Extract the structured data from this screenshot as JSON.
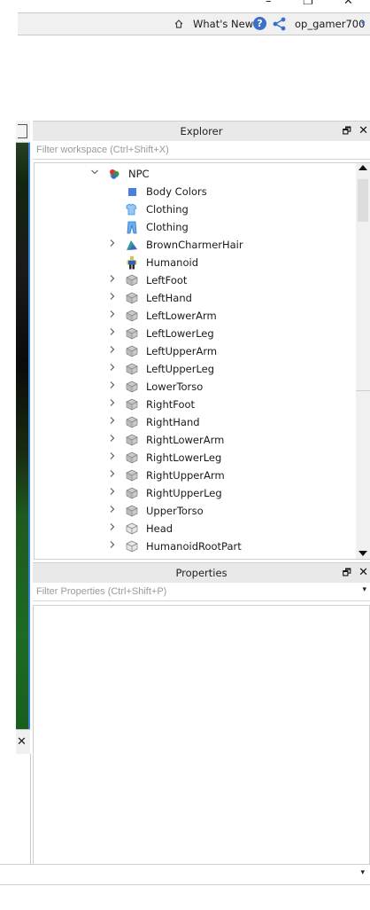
{
  "window_controls": {
    "minimize": "–",
    "restore": "❐",
    "close": "✕"
  },
  "topbar": {
    "whats_new": "What's New",
    "help": "?",
    "user": "op_gamer700",
    "dropdown": "▾"
  },
  "viewport": {
    "close": "✕"
  },
  "explorer": {
    "title": "Explorer",
    "float": "🗗",
    "close": "✕",
    "filter_placeholder": "Filter workspace (Ctrl+Shift+X)",
    "items": [
      {
        "label": "NPC",
        "icon": "model-icon",
        "expanded": true
      },
      {
        "label": "Body Colors",
        "icon": "body-colors-icon"
      },
      {
        "label": "Clothing",
        "icon": "shirt-icon"
      },
      {
        "label": "Clothing",
        "icon": "pants-icon"
      },
      {
        "label": "BrownCharmerHair",
        "icon": "accessory-icon"
      },
      {
        "label": "Humanoid",
        "icon": "humanoid-icon"
      },
      {
        "label": "LeftFoot",
        "icon": "meshpart-icon"
      },
      {
        "label": "LeftHand",
        "icon": "meshpart-icon"
      },
      {
        "label": "LeftLowerArm",
        "icon": "meshpart-icon"
      },
      {
        "label": "LeftLowerLeg",
        "icon": "meshpart-icon"
      },
      {
        "label": "LeftUpperArm",
        "icon": "meshpart-icon"
      },
      {
        "label": "LeftUpperLeg",
        "icon": "meshpart-icon"
      },
      {
        "label": "LowerTorso",
        "icon": "meshpart-icon"
      },
      {
        "label": "RightFoot",
        "icon": "meshpart-icon"
      },
      {
        "label": "RightHand",
        "icon": "meshpart-icon"
      },
      {
        "label": "RightLowerArm",
        "icon": "meshpart-icon"
      },
      {
        "label": "RightLowerLeg",
        "icon": "meshpart-icon"
      },
      {
        "label": "RightUpperArm",
        "icon": "meshpart-icon"
      },
      {
        "label": "RightUpperLeg",
        "icon": "meshpart-icon"
      },
      {
        "label": "UpperTorso",
        "icon": "meshpart-icon"
      },
      {
        "label": "Head",
        "icon": "part-icon"
      },
      {
        "label": "HumanoidRootPart",
        "icon": "part-icon"
      }
    ]
  },
  "properties": {
    "title": "Properties",
    "float": "🗗",
    "close": "✕",
    "filter_placeholder": "Filter Properties (Ctrl+Shift+P)",
    "dropdown": "▾"
  },
  "bottombar": {
    "dropdown": "▾"
  },
  "colors": {
    "accent": "#3c7fd6",
    "help_blue": "#3b6fc8"
  }
}
